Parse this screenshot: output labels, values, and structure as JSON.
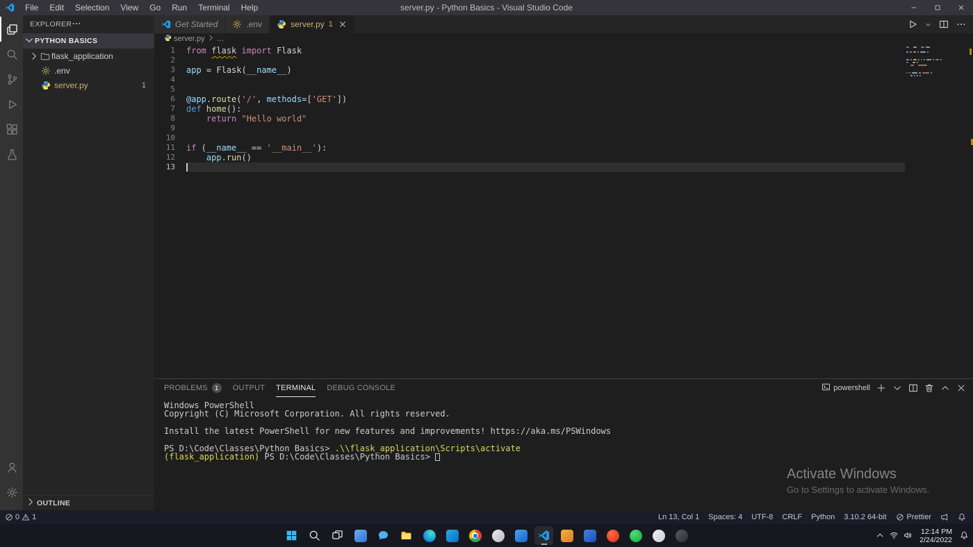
{
  "title_bar": {
    "app_title": "server.py - Python Basics - Visual Studio Code",
    "logo_icon": "vscode-icon",
    "menus": [
      "File",
      "Edit",
      "Selection",
      "View",
      "Go",
      "Run",
      "Terminal",
      "Help"
    ],
    "window_controls": [
      {
        "name": "minimize",
        "icon": "minimize-icon"
      },
      {
        "name": "maximize",
        "icon": "maximize-icon"
      },
      {
        "name": "close",
        "icon": "close-icon"
      }
    ]
  },
  "activity_bar": {
    "top": [
      {
        "name": "explorer",
        "icon": "files-icon",
        "active": true
      },
      {
        "name": "search",
        "icon": "search-icon"
      },
      {
        "name": "source-control",
        "icon": "source-control-icon"
      },
      {
        "name": "run-and-debug",
        "icon": "run-debug-icon"
      },
      {
        "name": "extensions",
        "icon": "extensions-icon"
      },
      {
        "name": "testing",
        "icon": "testing-icon"
      }
    ],
    "bottom": [
      {
        "name": "accounts",
        "icon": "account-icon"
      },
      {
        "name": "settings",
        "icon": "gear-icon"
      }
    ]
  },
  "sidebar": {
    "title": "EXPLORER",
    "more_actions_icon": "ellipsis-icon",
    "section": {
      "label": "PYTHON BASICS",
      "chevron_icon": "chevron-down-icon"
    },
    "files": [
      {
        "label": "flask_application",
        "icon": "folder-icon",
        "chevron": true
      },
      {
        "label": ".env",
        "icon": "env-gear-icon"
      },
      {
        "label": "server.py",
        "icon": "python-icon",
        "badge": "1",
        "warning": true
      }
    ],
    "outline": {
      "label": "OUTLINE",
      "chevron_icon": "chevron-right-icon"
    }
  },
  "editor": {
    "tabs": [
      {
        "label": "Get Started",
        "icon": "vscode-icon",
        "preview": true
      },
      {
        "label": ".env",
        "icon": "env-gear-icon"
      },
      {
        "label": "server.py",
        "icon": "python-icon",
        "badge": "1",
        "active": true,
        "warn": true,
        "close_icon": "close-icon"
      }
    ],
    "toolbar": [
      {
        "name": "run-python-file-button",
        "icon": "run-icon"
      },
      {
        "name": "run-dropdown",
        "icon": "chevron-down-icon",
        "narrow": true
      },
      {
        "name": "split-editor-button",
        "icon": "split-icon"
      },
      {
        "name": "editor-more-actions",
        "icon": "ellipsis-icon"
      }
    ],
    "breadcrumb": {
      "file_icon": "python-icon",
      "file": "server.py",
      "separator_icon": "chevron-right-icon",
      "symbol": "…"
    },
    "active_line": 13,
    "cursor_position": "Ln 13, Col 1",
    "lines": [
      {
        "n": 1,
        "tokens": [
          {
            "t": "from",
            "c": "kw"
          },
          {
            "t": " ",
            "c": "pl"
          },
          {
            "t": "flask",
            "c": "pl sq"
          },
          {
            "t": " ",
            "c": "pl"
          },
          {
            "t": "import",
            "c": "kw"
          },
          {
            "t": " Flask",
            "c": "pl"
          }
        ]
      },
      {
        "n": 2,
        "tokens": []
      },
      {
        "n": 3,
        "tokens": [
          {
            "t": "app",
            "c": "var"
          },
          {
            "t": " = ",
            "c": "pl"
          },
          {
            "t": "Flask",
            "c": "pl"
          },
          {
            "t": "(",
            "c": "pl"
          },
          {
            "t": "__name__",
            "c": "var"
          },
          {
            "t": ")",
            "c": "pl"
          }
        ]
      },
      {
        "n": 4,
        "tokens": []
      },
      {
        "n": 5,
        "tokens": []
      },
      {
        "n": 6,
        "tokens": [
          {
            "t": "@app",
            "c": "var"
          },
          {
            "t": ".",
            "c": "pl"
          },
          {
            "t": "route",
            "c": "fn"
          },
          {
            "t": "(",
            "c": "pl"
          },
          {
            "t": "'/'",
            "c": "str"
          },
          {
            "t": ", ",
            "c": "pl"
          },
          {
            "t": "methods",
            "c": "var"
          },
          {
            "t": "=[",
            "c": "pl"
          },
          {
            "t": "'GET'",
            "c": "str"
          },
          {
            "t": "])",
            "c": "pl"
          }
        ]
      },
      {
        "n": 7,
        "tokens": [
          {
            "t": "def",
            "c": "kw2"
          },
          {
            "t": " ",
            "c": "pl"
          },
          {
            "t": "home",
            "c": "fn"
          },
          {
            "t": "():",
            "c": "pl"
          }
        ]
      },
      {
        "n": 8,
        "tokens": [
          {
            "t": "    ",
            "c": "pl"
          },
          {
            "t": "return",
            "c": "kw"
          },
          {
            "t": " ",
            "c": "pl"
          },
          {
            "t": "\"Hello world\"",
            "c": "str"
          }
        ]
      },
      {
        "n": 9,
        "tokens": []
      },
      {
        "n": 10,
        "tokens": []
      },
      {
        "n": 11,
        "tokens": [
          {
            "t": "if",
            "c": "kw"
          },
          {
            "t": " (",
            "c": "pl"
          },
          {
            "t": "__name__",
            "c": "var"
          },
          {
            "t": " == ",
            "c": "pl"
          },
          {
            "t": "'__main__'",
            "c": "str"
          },
          {
            "t": "):",
            "c": "pl"
          }
        ]
      },
      {
        "n": 12,
        "tokens": [
          {
            "t": "    ",
            "c": "pl"
          },
          {
            "t": "app",
            "c": "var"
          },
          {
            "t": ".",
            "c": "pl"
          },
          {
            "t": "run",
            "c": "fn"
          },
          {
            "t": "()",
            "c": "pl"
          }
        ]
      },
      {
        "n": 13,
        "tokens": []
      }
    ]
  },
  "panel": {
    "tabs": [
      {
        "label": "PROBLEMS",
        "badge": "1"
      },
      {
        "label": "OUTPUT"
      },
      {
        "label": "TERMINAL",
        "active": true
      },
      {
        "label": "DEBUG CONSOLE"
      }
    ],
    "shell_icon": "terminal-icon",
    "shell_label": "powershell",
    "actions": [
      {
        "name": "new-terminal-button",
        "icon": "plus-icon"
      },
      {
        "name": "terminal-dropdown",
        "icon": "chevron-down-icon"
      },
      {
        "name": "split-terminal-button",
        "icon": "split-icon"
      },
      {
        "name": "kill-terminal-button",
        "icon": "trash-icon"
      },
      {
        "name": "maximize-panel-button",
        "icon": "chevron-up-icon"
      },
      {
        "name": "close-panel-button",
        "icon": "close-icon"
      }
    ],
    "terminal": [
      {
        "segs": [
          {
            "t": "Windows PowerShell",
            "c": "t"
          }
        ]
      },
      {
        "segs": [
          {
            "t": "Copyright (C) Microsoft Corporation. All rights reserved.",
            "c": "t"
          }
        ]
      },
      {
        "segs": []
      },
      {
        "segs": [
          {
            "t": "Install the latest PowerShell for new features and improvements! https://aka.ms/PSWindows",
            "c": "t"
          }
        ]
      },
      {
        "segs": []
      },
      {
        "segs": [
          {
            "t": "PS D:\\Code\\Classes\\Python Basics> ",
            "c": "t"
          },
          {
            "t": ".\\\\flask_application\\Scripts\\activate",
            "c": "y"
          }
        ]
      },
      {
        "segs": [
          {
            "t": "(flask_application)",
            "c": "y"
          },
          {
            "t": " PS D:\\Code\\Classes\\Python Basics> ",
            "c": "t"
          },
          {
            "t": "",
            "c": "cursor"
          }
        ]
      }
    ]
  },
  "watermark": {
    "title": "Activate Windows",
    "subtitle": "Go to Settings to activate Windows."
  },
  "status_bar": {
    "error_icon": "circle-slash-icon",
    "errors": "0",
    "warning_icon": "warning-icon",
    "warnings": "1",
    "items": [
      "Ln 13, Col 1",
      "Spaces: 4",
      "UTF-8",
      "CRLF",
      "Python",
      "3.10.2 64-bit"
    ],
    "prettier_icon": "circle-slash-icon",
    "prettier_label": "Prettier",
    "feedback_icon": "megaphone-icon",
    "notifications_icon": "bell-icon"
  },
  "taskbar": {
    "apps": [
      {
        "name": "start",
        "icon": "windows-start-icon"
      },
      {
        "name": "search",
        "icon": "taskbar-search-icon"
      },
      {
        "name": "task-view",
        "icon": "task-view-icon"
      },
      {
        "name": "widgets",
        "shape": "rounded",
        "bg": "linear-gradient(135deg,#62b0f0,#3b6fd4)"
      },
      {
        "name": "chat",
        "icon": "chat-icon"
      },
      {
        "name": "file-explorer",
        "icon": "file-explorer-icon"
      },
      {
        "name": "edge",
        "shape": "circle",
        "bg": "radial-gradient(circle at 62% 30%,#45e6b6,#1d9ae6 55%,#0b57a8)"
      },
      {
        "name": "outlook",
        "shape": "rounded",
        "bg": "linear-gradient(135deg,#28a8ea,#0f6cbd)"
      },
      {
        "name": "chrome",
        "shape": "circle",
        "bg": "conic-gradient(#ea4335 0 33%,#34a853 33% 66%,#fbbc04 66% 100%)"
      },
      {
        "name": "app-gray",
        "shape": "circle",
        "bg": "linear-gradient(135deg,#ececec,#b9b9c0)"
      },
      {
        "name": "app-blue",
        "shape": "rounded",
        "bg": "linear-gradient(135deg,#4aa3f0,#1763c6)"
      },
      {
        "name": "vscode",
        "icon": "vscode-icon",
        "active": true
      },
      {
        "name": "app-orange",
        "shape": "rounded",
        "bg": "linear-gradient(135deg,#f2b43c,#d97d1c)"
      },
      {
        "name": "app-blue-2",
        "shape": "rounded",
        "bg": "linear-gradient(135deg,#3f83e8,#1b4fae)"
      },
      {
        "name": "app-red",
        "shape": "circle",
        "bg": "radial-gradient(circle at 35% 30%,#ff6a4d,#d92d12)"
      },
      {
        "name": "app-green",
        "shape": "circle",
        "bg": "radial-gradient(circle at 35% 30%,#4fdc74,#14a83b)"
      },
      {
        "name": "app-light",
        "shape": "circle",
        "bg": "linear-gradient(135deg,#f4f4f6,#c9cbd4)"
      },
      {
        "name": "app-dark",
        "shape": "circle",
        "bg": "linear-gradient(135deg,#5a5a66,#2c2c34)"
      }
    ],
    "tray": {
      "expand_icon": "chevron-up-icon",
      "icons": [
        "wifi-icon",
        "volume-icon"
      ],
      "time": "12:14 PM",
      "date": "2/24/2022",
      "notifications_icon": "bell-icon"
    }
  },
  "colors": {
    "file_warning": "#ccb371",
    "terminal_command": "#d8d85a",
    "keyword": "#c586c0",
    "keyword2": "#569cd6",
    "variable": "#9cdcfe",
    "function": "#dcdcaa",
    "string": "#ce9178",
    "overview_warning_mark": "#bf8803"
  }
}
